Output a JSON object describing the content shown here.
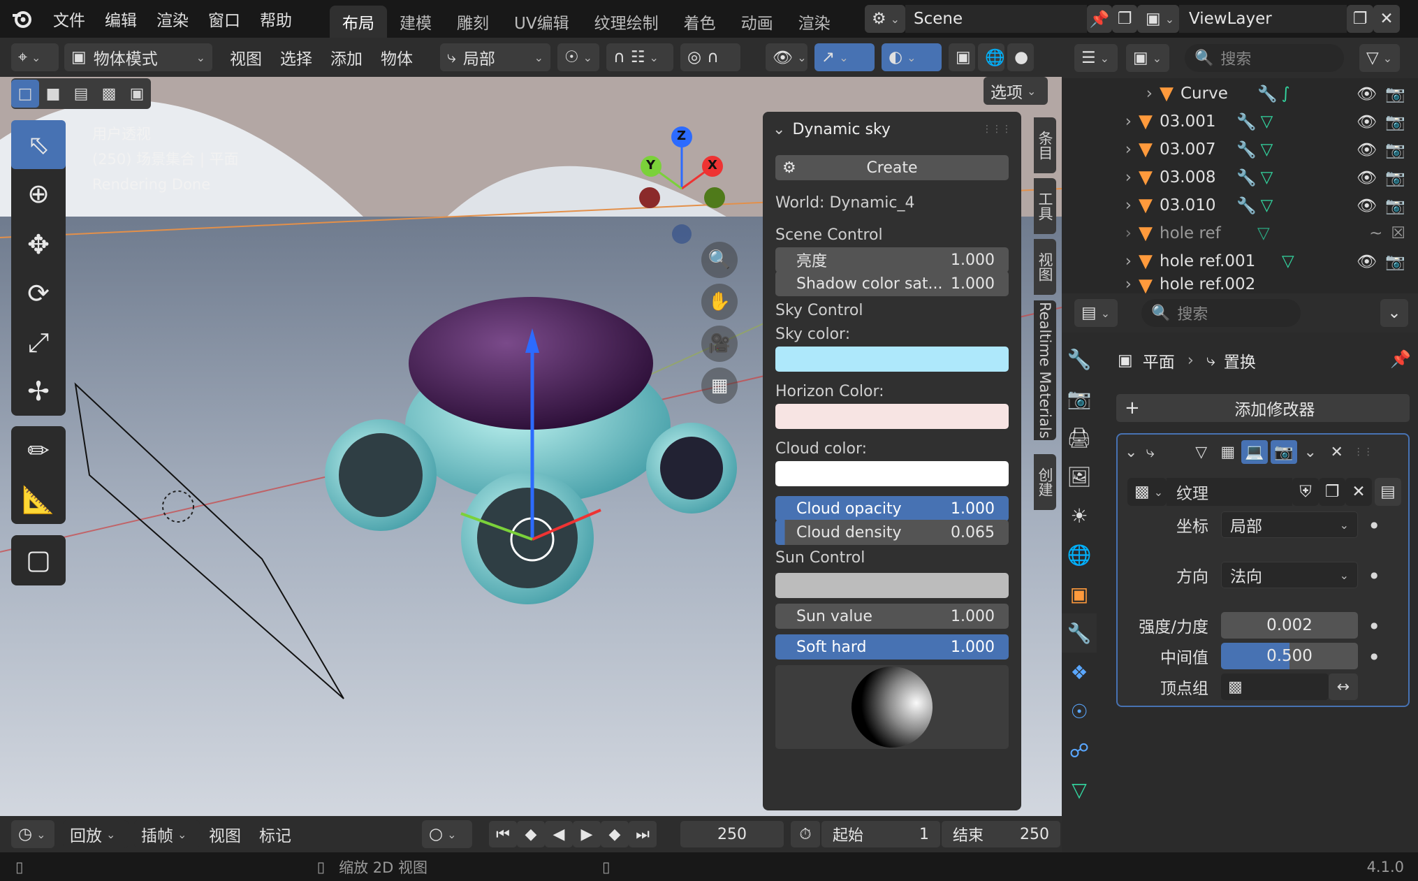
{
  "topbar": {
    "menus": [
      "文件",
      "编辑",
      "渲染",
      "窗口",
      "帮助"
    ],
    "workspaces": [
      "布局",
      "建模",
      "雕刻",
      "UV编辑",
      "纹理绘制",
      "着色",
      "动画",
      "渲染"
    ],
    "active_workspace": "布局",
    "scene": "Scene",
    "view_layer": "ViewLayer"
  },
  "viewport_header": {
    "mode": "物体模式",
    "menus": [
      "视图",
      "选择",
      "添加",
      "物体"
    ],
    "transform_orientation": "局部",
    "options": "选项"
  },
  "viewport": {
    "info_lines": [
      "用户透视",
      "(250) 场景集合 | 平面",
      "Rendering Done"
    ],
    "gizmo": {
      "z": "Z",
      "y": "Y",
      "x": "X"
    }
  },
  "sky_panel": {
    "title": "Dynamic sky",
    "create": "Create",
    "world": "World: Dynamic_4",
    "scene_control": "Scene Control",
    "brightness_label": "亮度",
    "brightness": "1.000",
    "shadow_label": "Shadow color sat...",
    "shadow": "1.000",
    "sky_control": "Sky Control",
    "sky_color_label": "Sky color:",
    "sky_color": "#aee8fb",
    "horizon_label": "Horizon Color:",
    "horizon_color": "#f7e4e3",
    "cloud_color_label": "Cloud color:",
    "cloud_color": "#ffffff",
    "cloud_opacity_label": "Cloud opacity",
    "cloud_opacity": "1.000",
    "cloud_density_label": "Cloud density",
    "cloud_density": "0.065",
    "sun_control": "Sun Control",
    "sun_value_label": "Sun value",
    "sun_value": "1.000",
    "soft_hard_label": "Soft hard",
    "soft_hard": "1.000"
  },
  "sidebar_tabs": [
    "条目",
    "工具",
    "视图",
    "Realtime Materials",
    "创建"
  ],
  "outliner": {
    "search_placeholder": "搜索",
    "rows": [
      {
        "name": "Curve"
      },
      {
        "name": "03.001"
      },
      {
        "name": "03.007"
      },
      {
        "name": "03.008"
      },
      {
        "name": "03.010"
      },
      {
        "name": "hole ref"
      },
      {
        "name": "hole ref.001"
      },
      {
        "name": "hole ref.002"
      }
    ]
  },
  "properties": {
    "search_placeholder": "搜索",
    "breadcrumb_object": "平面",
    "breadcrumb_modifier": "置换",
    "add_modifier": "添加修改器",
    "texture": "纹理",
    "coord_label": "坐标",
    "coord_value": "局部",
    "direction_label": "方向",
    "direction_value": "法向",
    "strength_label": "强度/力度",
    "strength_value": "0.002",
    "midlevel_label": "中间值",
    "midlevel_value": "0.500",
    "midlevel_fraction": 0.5,
    "vgroup_label": "顶点组"
  },
  "timeline": {
    "playback": "回放",
    "keying": "插帧",
    "view": "视图",
    "marker": "标记",
    "current_frame": "250",
    "start_label": "起始",
    "start": "1",
    "end_label": "结束",
    "end": "250"
  },
  "statusbar": {
    "hint": "缩放 2D 视图",
    "version": "4.1.0"
  }
}
